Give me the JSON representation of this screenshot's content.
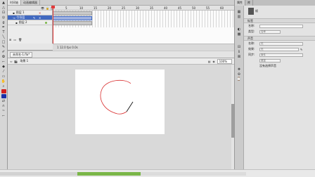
{
  "timeline": {
    "tabs": [
      "时间轴",
      "动画编辑器"
    ],
    "layers": [
      {
        "name": "图层 1"
      },
      {
        "name": "引导层"
      },
      {
        "name": "图层 2"
      }
    ],
    "frame_numbers": [
      "5",
      "10",
      "15",
      "20",
      "25",
      "30",
      "35",
      "40",
      "45",
      "50",
      "55",
      "60",
      "65"
    ],
    "status": "1  12.0 fps  0.0s"
  },
  "stage": {
    "tab": "未命名-1.fla*",
    "scene": "场景 1",
    "zoom": "100%"
  },
  "properties": {
    "tabs": [
      "属性",
      "库"
    ],
    "object": "帧",
    "label_section": "标签",
    "name_label": "名称:",
    "type_label": "类型:",
    "type_value": "名称",
    "sound_section": "声音",
    "sound_name_label": "名称:",
    "sound_name_value": "无",
    "effect_label": "效果:",
    "effect_value": "无",
    "sync_label": "同步:",
    "sync_value": "事件",
    "repeat_value": "重复",
    "sound_note": "没有选择声音"
  },
  "colors": {
    "selection": "#4169c0",
    "playhead": "#e23b3b",
    "stroke": "#d93030",
    "accent_green": "#7ab648"
  }
}
